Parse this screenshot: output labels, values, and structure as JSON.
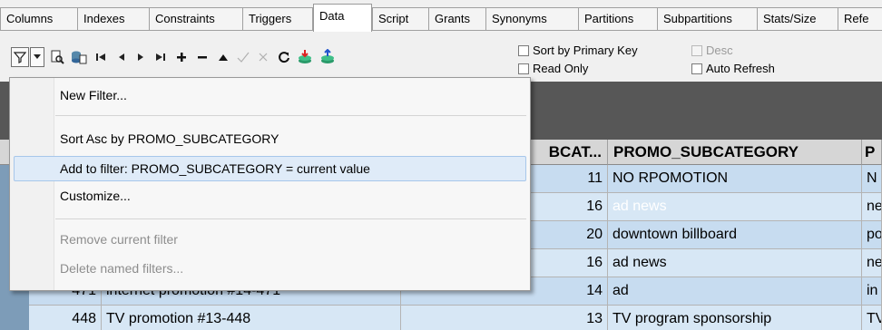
{
  "tabs": [
    "Columns",
    "Indexes",
    "Constraints",
    "Triggers",
    "Data",
    "Script",
    "Grants",
    "Synonyms",
    "Partitions",
    "Subpartitions",
    "Stats/Size",
    "Refe"
  ],
  "active_tab": "Data",
  "toolbar": {
    "sort_by_pk_label": "Sort by Primary Key",
    "desc_label": "Desc",
    "read_only_label": "Read Only",
    "auto_refresh_label": "Auto Refresh"
  },
  "menu": {
    "new_filter": "New Filter...",
    "sort_asc": "Sort Asc by PROMO_SUBCATEGORY",
    "add_to_filter": "Add to filter:  PROMO_SUBCATEGORY = current value",
    "customize": "Customize...",
    "remove_filter": "Remove current filter",
    "delete_named": "Delete named filters..."
  },
  "grid": {
    "columns": [
      "BCAT...",
      "PROMO_SUBCATEGORY",
      "P"
    ],
    "rows": [
      {
        "id": "",
        "name": "",
        "cat": "11",
        "sub": "NO RPOMOTION",
        "p": "N"
      },
      {
        "id": "",
        "name": "",
        "cat": "16",
        "sub": "ad news",
        "p": "ne"
      },
      {
        "id": "",
        "name": "",
        "cat": "20",
        "sub": "downtown billboard",
        "p": "po"
      },
      {
        "id": "",
        "name": "",
        "cat": "16",
        "sub": "ad news",
        "p": "ne"
      },
      {
        "id": "471",
        "name": "internet promotion #14-471",
        "cat": "14",
        "sub": "ad",
        "p": "in"
      },
      {
        "id": "448",
        "name": "TV promotion #13-448",
        "cat": "13",
        "sub": "TV program sponsorship",
        "p": "TV"
      }
    ]
  }
}
